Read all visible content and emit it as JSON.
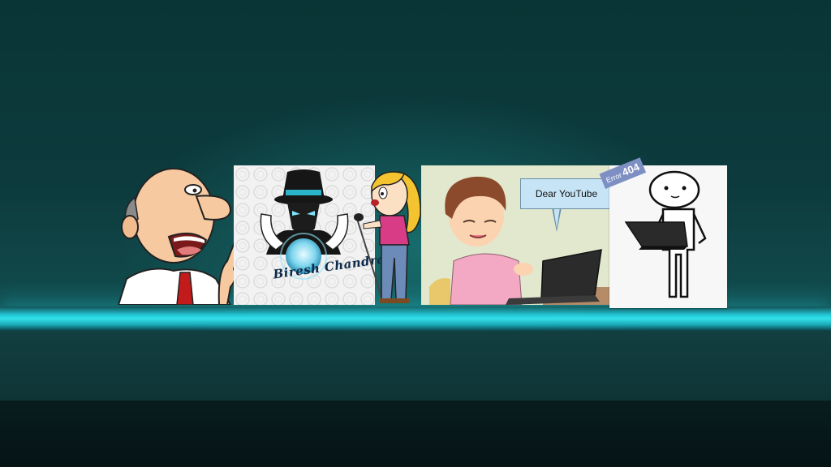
{
  "scene": {
    "type": "channel-banner",
    "accent_color": "#22c7d6",
    "background_color": "#0b2c2e"
  },
  "crystal_panel": {
    "signature": "Biresh Chandra",
    "figure": "mystic-hat-icon"
  },
  "laptop_panel": {
    "speech_bubble_text": "Dear YouTube",
    "figure": "boy-with-laptop-icon"
  },
  "stick_panel": {
    "badge_word": "Error",
    "badge_code": "404",
    "figure": "stick-figure-laptop-icon"
  },
  "cartoons": {
    "left": "bald-man-pointing-icon",
    "middle": "girl-with-microphone-icon"
  }
}
